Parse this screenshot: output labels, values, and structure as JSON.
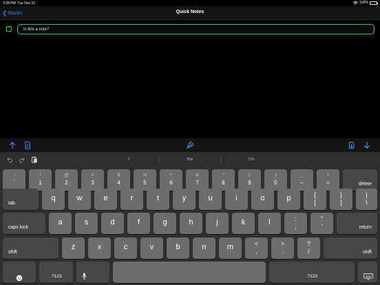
{
  "status_bar": {
    "time": "3:28 PM",
    "date": "Tue Nov 10",
    "battery": "100%",
    "wifi_icon": "wifi-icon",
    "battery_icon": "battery-icon"
  },
  "nav": {
    "back_label": "Stacks",
    "title": "Quick Notes"
  },
  "note": {
    "help_label": "?",
    "value": "Is this a note?"
  },
  "colors": {
    "accent": "#30d158",
    "link": "#3f8fff",
    "key": "#6d6d6d",
    "key_dark": "#474747",
    "keyboard_bg": "#2f2f2f"
  },
  "toolbar": {
    "icons": [
      "arrow-up-icon",
      "document-icon",
      "pen-tip-icon",
      "clipboard-doc-icon",
      "arrow-down-icon"
    ]
  },
  "predictive": {
    "suggestions": [
      "I",
      "the",
      "I'm"
    ],
    "icons": [
      "undo-icon",
      "redo-icon",
      "paste-icon"
    ]
  },
  "keys": {
    "row1": [
      {
        "top": "~",
        "bottom": "`"
      },
      {
        "top": "!",
        "bottom": "1"
      },
      {
        "top": "@",
        "bottom": "2"
      },
      {
        "top": "#",
        "bottom": "3"
      },
      {
        "top": "$",
        "bottom": "4"
      },
      {
        "top": "%",
        "bottom": "5"
      },
      {
        "top": "^",
        "bottom": "6"
      },
      {
        "top": "&",
        "bottom": "7"
      },
      {
        "top": "*",
        "bottom": "8"
      },
      {
        "top": "(",
        "bottom": "9"
      },
      {
        "top": ")",
        "bottom": "0"
      },
      {
        "top": "_",
        "bottom": "–"
      },
      {
        "top": "+",
        "bottom": "="
      }
    ],
    "delete": "delete",
    "tab": "tab",
    "row2": [
      "q",
      "w",
      "e",
      "r",
      "t",
      "y",
      "u",
      "i",
      "o",
      "p"
    ],
    "row2_dual": [
      {
        "top": "{",
        "bottom": "["
      },
      {
        "top": "}",
        "bottom": "]"
      },
      {
        "top": "|",
        "bottom": "\\"
      }
    ],
    "caps": "caps lock",
    "row3": [
      "a",
      "s",
      "d",
      "f",
      "g",
      "h",
      "j",
      "k",
      "l"
    ],
    "row3_dual": [
      {
        "top": ":",
        "bottom": ";"
      },
      {
        "top": "\"",
        "bottom": "'"
      }
    ],
    "return": "return",
    "shift": "shift",
    "row4": [
      "z",
      "x",
      "c",
      "v",
      "b",
      "n",
      "m"
    ],
    "row4_dual": [
      {
        "top": "<",
        "bottom": ","
      },
      {
        "top": ">",
        "bottom": "."
      },
      {
        "top": "?",
        "bottom": "/"
      }
    ],
    "numbers": ".?123"
  }
}
